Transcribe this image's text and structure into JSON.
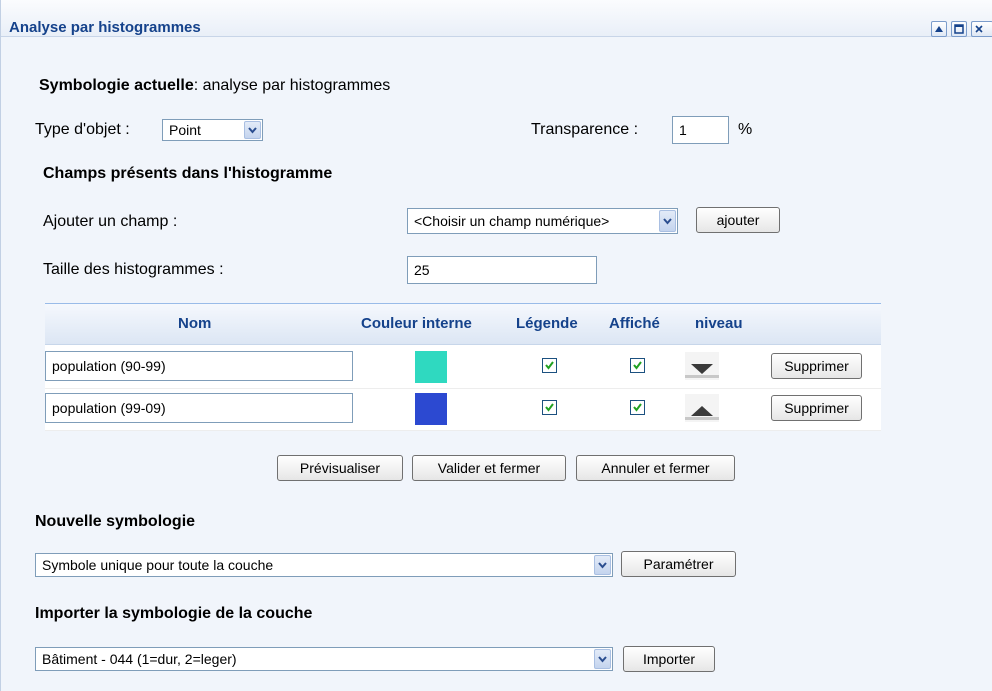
{
  "window": {
    "title": "Analyse par histogrammes",
    "controls": [
      "collapse-icon",
      "maximize-icon",
      "close-icon"
    ]
  },
  "current": {
    "label": "Symbologie actuelle",
    "value": ": analyse par histogrammes"
  },
  "object_type": {
    "label": "Type d'objet :",
    "value": "Point"
  },
  "transparency": {
    "label": "Transparence :",
    "value": "1",
    "unit": "%"
  },
  "fields_section": {
    "title": "Champs présents dans l'histogramme",
    "add_label": "Ajouter un champ :",
    "add_select": "<Choisir un champ numérique>",
    "add_button": "ajouter",
    "size_label": "Taille des histogrammes :",
    "size_value": "25"
  },
  "grid": {
    "headers": {
      "name": "Nom",
      "color": "Couleur interne",
      "legend": "Légende",
      "shown": "Affiché",
      "level": "niveau"
    },
    "rows": [
      {
        "name": "population (90-99)",
        "color": "#2fd9c0",
        "legend": true,
        "shown": true,
        "level": "down-arrow-icon",
        "delete": "Supprimer"
      },
      {
        "name": "population (99-09)",
        "color": "#2c49d1",
        "legend": true,
        "shown": true,
        "level": "up-arrow-icon",
        "delete": "Supprimer"
      }
    ]
  },
  "actions": {
    "preview": "Prévisualiser",
    "validate": "Valider et fermer",
    "cancel": "Annuler et fermer"
  },
  "new_symbology": {
    "title": "Nouvelle symbologie",
    "select": "Symbole unique pour toute la couche",
    "button": "Paramétrer"
  },
  "import_symbology": {
    "title": "Importer la symbologie de la couche",
    "select": "Bâtiment - 044 (1=dur, 2=leger)",
    "button": "Importer"
  }
}
